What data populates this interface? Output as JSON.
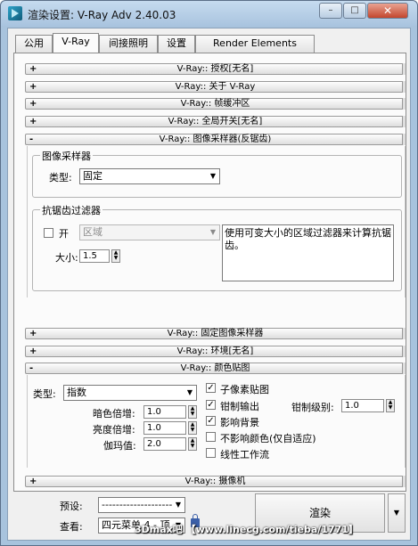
{
  "window": {
    "title": "渲染设置: V-Ray Adv 2.40.03",
    "minimize": "–",
    "maximize": "□",
    "close": "✕"
  },
  "tabs": [
    {
      "label": "公用"
    },
    {
      "label": "V-Ray"
    },
    {
      "label": "间接照明"
    },
    {
      "label": "设置"
    },
    {
      "label": "Render Elements"
    }
  ],
  "rollouts": {
    "authorization": {
      "sign": "+",
      "title": "V-Ray:: 授权[无名]"
    },
    "about": {
      "sign": "+",
      "title": "V-Ray:: 关于 V-Ray"
    },
    "framebuffer": {
      "sign": "+",
      "title": "V-Ray:: 帧缓冲区"
    },
    "global_switches": {
      "sign": "+",
      "title": "V-Ray:: 全局开关[无名]"
    },
    "image_sampler": {
      "sign": "-",
      "title": "V-Ray:: 图像采样器(反锯齿)"
    },
    "fixed_sampler": {
      "sign": "+",
      "title": "V-Ray:: 固定图像采样器"
    },
    "environment": {
      "sign": "+",
      "title": "V-Ray:: 环境[无名]"
    },
    "color_mapping": {
      "sign": "-",
      "title": "V-Ray:: 颜色贴图"
    },
    "camera": {
      "sign": "+",
      "title": "V-Ray:: 摄像机"
    }
  },
  "image_sampler": {
    "group_title": "图像采样器",
    "type_label": "类型:",
    "type_value": "固定",
    "aa_group_title": "抗锯齿过滤器",
    "on_label": "开",
    "filter_value": "区域",
    "size_label": "大小:",
    "size_value": "1.5",
    "description": "使用可变大小的区域过滤器来计算抗锯齿。"
  },
  "color_mapping": {
    "type_label": "类型:",
    "type_value": "指数",
    "dark_label": "暗色倍增:",
    "dark_value": "1.0",
    "bright_label": "亮度倍增:",
    "bright_value": "1.0",
    "gamma_label": "伽玛值:",
    "gamma_value": "2.0",
    "sub_pixel_label": "子像素贴图",
    "sub_pixel_checked": true,
    "clamp_label": "钳制输出",
    "clamp_checked": true,
    "clamp_level_label": "钳制级别:",
    "clamp_level_value": "1.0",
    "affect_bg_label": "影响背景",
    "affect_bg_checked": true,
    "no_affect_label": "不影响颜色(仅自适应)",
    "no_affect_checked": false,
    "linear_label": "线性工作流",
    "linear_checked": false
  },
  "bottom": {
    "preset_label": "预设:",
    "preset_value": "--------------------",
    "view_label": "查看:",
    "view_value": "四元菜单 4 - 顶",
    "render_label": "渲染"
  },
  "watermark": "3Dmax吧 【www.linecg.com/tieba/1771】"
}
